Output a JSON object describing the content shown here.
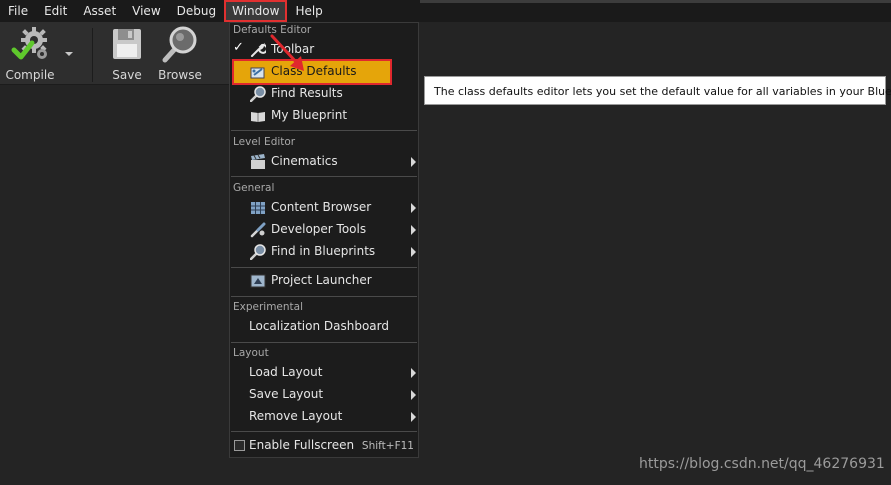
{
  "menubar": {
    "items": [
      "File",
      "Edit",
      "Asset",
      "View",
      "Debug",
      "Window",
      "Help"
    ],
    "active_item": "Window"
  },
  "toolbar": {
    "compile_label": "Compile",
    "save_label": "Save",
    "browse_label": "Browse"
  },
  "window_menu": {
    "sections": {
      "defaults_editor": "Defaults Editor",
      "level_editor": "Level Editor",
      "general": "General",
      "experimental": "Experimental",
      "layout": "Layout"
    },
    "items": {
      "toolbar": "Toolbar",
      "class_defaults": "Class Defaults",
      "find_results": "Find Results",
      "my_blueprint": "My Blueprint",
      "cinematics": "Cinematics",
      "content_browser": "Content Browser",
      "developer_tools": "Developer Tools",
      "find_in_blueprints": "Find in Blueprints",
      "project_launcher": "Project Launcher",
      "localization_dashboard": "Localization Dashboard",
      "load_layout": "Load Layout",
      "save_layout": "Save Layout",
      "remove_layout": "Remove Layout",
      "enable_fullscreen": "Enable Fullscreen"
    },
    "checked_item": "Toolbar",
    "highlighted_item": "Class Defaults",
    "fullscreen_shortcut": "Shift+F11",
    "checkmark": "✓"
  },
  "tooltip": {
    "text": "The class defaults editor lets you set the default value for all variables in your Blueprint."
  },
  "watermark": {
    "text": "https://blog.csdn.net/qq_46276931"
  },
  "colors": {
    "highlight": "#e5a50a",
    "annotation_red": "#e0282d",
    "menu_background": "#1c1c1c",
    "editor_background": "#242424"
  },
  "icons": {
    "compile": "gear-check-icon",
    "save": "floppy-disk-icon",
    "browse": "magnifier-icon",
    "toolbar": "wrench-icon",
    "class_defaults": "class-defaults-icon",
    "find_results": "magnifier-icon",
    "my_blueprint": "book-icon",
    "cinematics": "clapperboard-icon",
    "content_browser": "grid-browser-icon",
    "developer_tools": "tools-icon",
    "find_in_blueprints": "magnifier-icon",
    "project_launcher": "launcher-icon"
  }
}
